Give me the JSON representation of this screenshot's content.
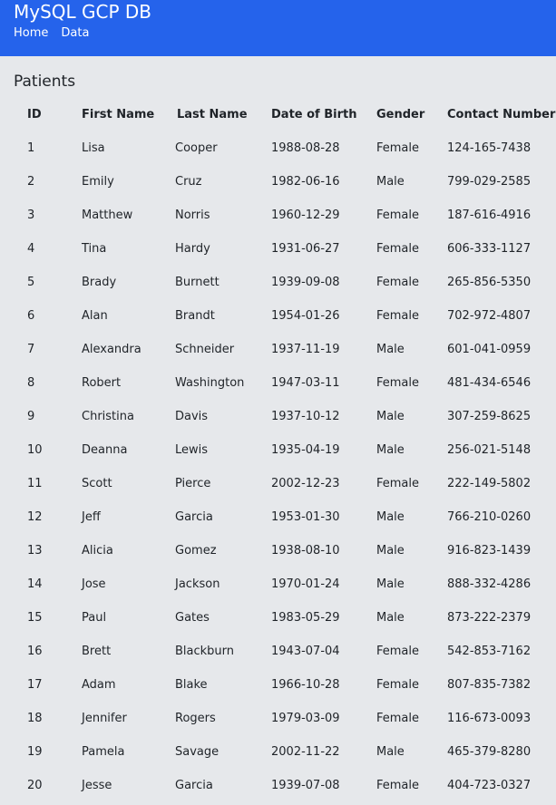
{
  "app": {
    "brand": "MySQL GCP DB",
    "nav": [
      "Home",
      "Data"
    ]
  },
  "page": {
    "title": "Patients"
  },
  "table": {
    "headers": [
      "ID",
      "First Name",
      "Last Name",
      "Date of Birth",
      "Gender",
      "Contact Number"
    ],
    "rows": [
      [
        "1",
        "Lisa",
        "Cooper",
        "1988-08-28",
        "Female",
        "124-165-7438"
      ],
      [
        "2",
        "Emily",
        "Cruz",
        "1982-06-16",
        "Male",
        "799-029-2585"
      ],
      [
        "3",
        "Matthew",
        "Norris",
        "1960-12-29",
        "Female",
        "187-616-4916"
      ],
      [
        "4",
        "Tina",
        "Hardy",
        "1931-06-27",
        "Female",
        "606-333-1127"
      ],
      [
        "5",
        "Brady",
        "Burnett",
        "1939-09-08",
        "Female",
        "265-856-5350"
      ],
      [
        "6",
        "Alan",
        "Brandt",
        "1954-01-26",
        "Female",
        "702-972-4807"
      ],
      [
        "7",
        "Alexandra",
        "Schneider",
        "1937-11-19",
        "Male",
        "601-041-0959"
      ],
      [
        "8",
        "Robert",
        "Washington",
        "1947-03-11",
        "Female",
        "481-434-6546"
      ],
      [
        "9",
        "Christina",
        "Davis",
        "1937-10-12",
        "Male",
        "307-259-8625"
      ],
      [
        "10",
        "Deanna",
        "Lewis",
        "1935-04-19",
        "Male",
        "256-021-5148"
      ],
      [
        "11",
        "Scott",
        "Pierce",
        "2002-12-23",
        "Female",
        "222-149-5802"
      ],
      [
        "12",
        "Jeff",
        "Garcia",
        "1953-01-30",
        "Male",
        "766-210-0260"
      ],
      [
        "13",
        "Alicia",
        "Gomez",
        "1938-08-10",
        "Male",
        "916-823-1439"
      ],
      [
        "14",
        "Jose",
        "Jackson",
        "1970-01-24",
        "Male",
        "888-332-4286"
      ],
      [
        "15",
        "Paul",
        "Gates",
        "1983-05-29",
        "Male",
        "873-222-2379"
      ],
      [
        "16",
        "Brett",
        "Blackburn",
        "1943-07-04",
        "Female",
        "542-853-7162"
      ],
      [
        "17",
        "Adam",
        "Blake",
        "1966-10-28",
        "Female",
        "807-835-7382"
      ],
      [
        "18",
        "Jennifer",
        "Rogers",
        "1979-03-09",
        "Female",
        "116-673-0093"
      ],
      [
        "19",
        "Pamela",
        "Savage",
        "2002-11-22",
        "Male",
        "465-379-8280"
      ],
      [
        "20",
        "Jesse",
        "Garcia",
        "1939-07-08",
        "Female",
        "404-723-0327"
      ]
    ]
  },
  "colors": {
    "navbar": "#2563eb",
    "background": "#e6e8eb",
    "text": "#1f2328"
  }
}
